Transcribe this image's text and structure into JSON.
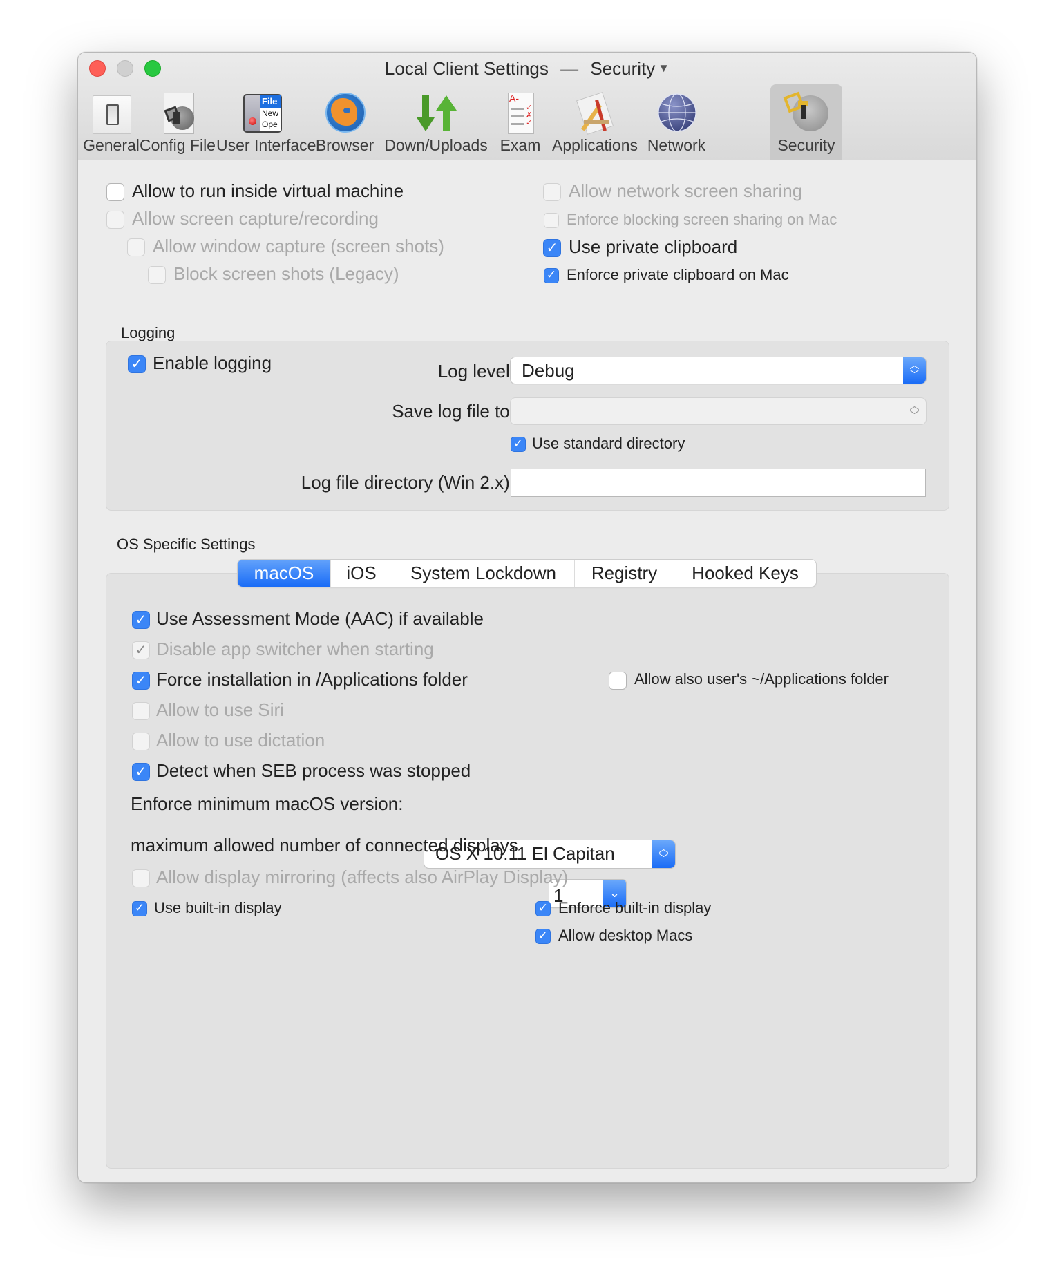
{
  "window": {
    "title": "Local Client Settings",
    "separator": "—",
    "subtitle": "Security",
    "title_menu_icon": "triangle-down"
  },
  "traffic_lights": {
    "close": "#fe5f57",
    "minimize": "#cfcfcf",
    "zoom": "#28c840"
  },
  "toolbar": {
    "items": [
      {
        "label": "General",
        "icon": "switch-icon",
        "selected": false
      },
      {
        "label": "Config File",
        "icon": "config-file-icon",
        "selected": false
      },
      {
        "label": "User Interface",
        "icon": "user-interface-icon",
        "selected": false
      },
      {
        "label": "Browser",
        "icon": "browser-globe-icon",
        "selected": false
      },
      {
        "label": "Down/Uploads",
        "icon": "down-up-arrows-icon",
        "selected": false
      },
      {
        "label": "Exam",
        "icon": "exam-sheet-icon",
        "selected": false
      },
      {
        "label": "Applications",
        "icon": "applications-icon",
        "selected": false
      },
      {
        "label": "Network",
        "icon": "network-globe-icon",
        "selected": false
      },
      {
        "label": "Security",
        "icon": "security-key-icon",
        "selected": true
      }
    ],
    "ui_icon_texts": {
      "file": "File",
      "new": "New",
      "open": "Ope"
    },
    "exam_grade": "A-"
  },
  "top_options": {
    "left": [
      {
        "label": "Allow to run inside virtual machine",
        "checked": false,
        "enabled": true
      },
      {
        "label": "Allow screen capture/recording",
        "checked": false,
        "enabled": false
      },
      {
        "label": "Allow window capture (screen shots)",
        "checked": false,
        "enabled": false
      },
      {
        "label": "Block screen shots (Legacy)",
        "checked": false,
        "enabled": false
      }
    ],
    "right": [
      {
        "label": "Allow network screen sharing",
        "checked": false,
        "enabled": false
      },
      {
        "label": "Enforce blocking screen sharing on Mac",
        "checked": false,
        "enabled": false
      },
      {
        "label": "Use private clipboard",
        "checked": true,
        "enabled": true
      },
      {
        "label": "Enforce private clipboard on Mac",
        "checked": true,
        "enabled": true
      }
    ]
  },
  "logging": {
    "group_label": "Logging",
    "enable_logging": {
      "label": "Enable logging",
      "checked": true
    },
    "log_level_label": "Log level:",
    "log_level_value": "Debug",
    "save_log_label": "Save log file to:",
    "save_log_value": "",
    "use_standard_dir": {
      "label": "Use standard directory",
      "checked": true
    },
    "win_dir_label": "Log file directory (Win 2.x):",
    "win_dir_value": ""
  },
  "os_specific": {
    "group_label": "OS Specific Settings",
    "tabs": [
      {
        "label": "macOS",
        "active": true
      },
      {
        "label": "iOS",
        "active": false
      },
      {
        "label": "System Lockdown",
        "active": false
      },
      {
        "label": "Registry",
        "active": false
      },
      {
        "label": "Hooked Keys",
        "active": false
      }
    ],
    "options": [
      {
        "label": "Use Assessment Mode (AAC) if available",
        "checked": true,
        "enabled": true
      },
      {
        "label": "Disable app switcher when starting",
        "checked": true,
        "enabled": false
      },
      {
        "label": "Force installation in /Applications folder",
        "checked": true,
        "enabled": true
      },
      {
        "label": "Allow to use Siri",
        "checked": false,
        "enabled": false
      },
      {
        "label": "Allow to use dictation",
        "checked": false,
        "enabled": false
      },
      {
        "label": "Detect when SEB process was stopped",
        "checked": true,
        "enabled": true
      }
    ],
    "allow_user_apps": {
      "label": "Allow also user's ~/Applications folder",
      "checked": false,
      "enabled": true
    },
    "min_version_label": "Enforce minimum macOS version:",
    "min_version_value": "OS X 10.11 El Capitan",
    "max_displays_label": "maximum allowed number of connected displays",
    "max_displays_value": "1",
    "display_mirroring": {
      "label": "Allow display mirroring (affects also AirPlay Display)",
      "checked": false,
      "enabled": false
    },
    "use_builtin_display": {
      "label": "Use built-in display",
      "checked": true,
      "enabled": true
    },
    "enforce_builtin_display": {
      "label": "Enforce built-in display",
      "checked": true,
      "enabled": true
    },
    "allow_desktop_macs": {
      "label": "Allow desktop Macs",
      "checked": true,
      "enabled": true
    }
  },
  "colors": {
    "accent": "#1a6cf6",
    "checkbox_on": "#3b86f7"
  }
}
